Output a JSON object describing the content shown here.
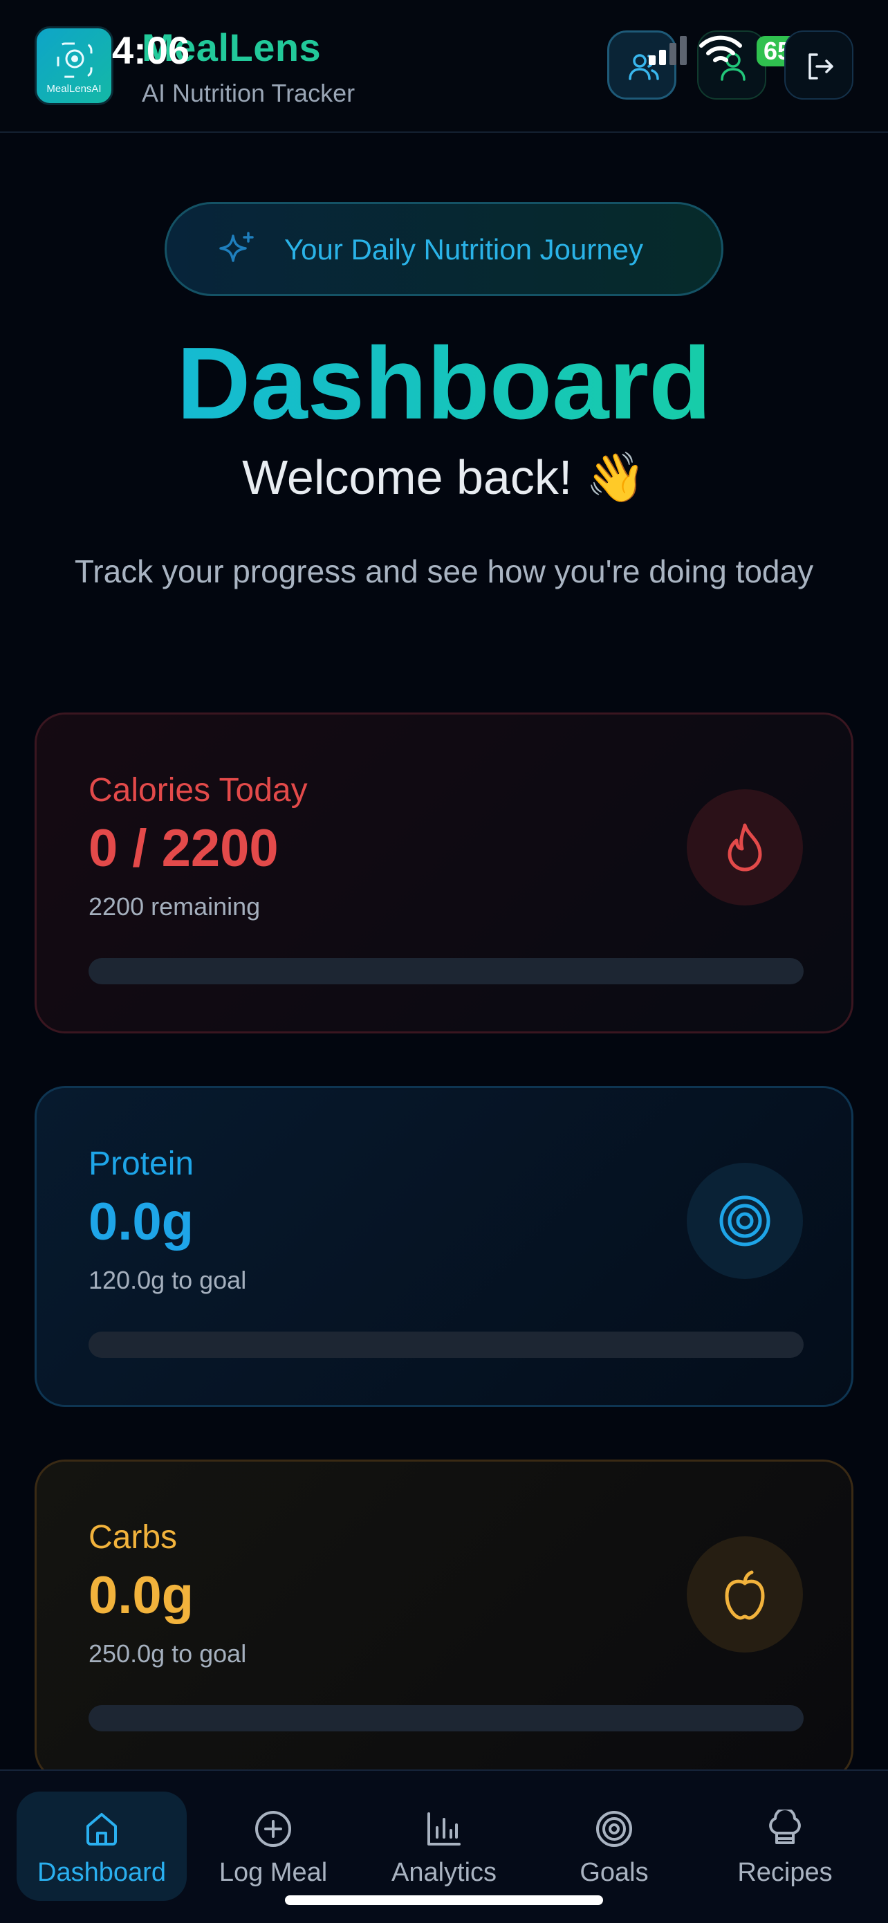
{
  "header": {
    "app_title": "MealLens",
    "app_subtitle": "AI Nutrition Tracker",
    "logo_text": "MealLensAI",
    "status_time": "4:06",
    "battery": "65"
  },
  "hero": {
    "pill_text": "Your Daily Nutrition Journey",
    "title": "Dashboard",
    "welcome": "Welcome back! 👋",
    "tagline": "Track your progress and see how you're doing today"
  },
  "cards": {
    "calories": {
      "label": "Calories Today",
      "value": "0 / 2200",
      "sub": "2200 remaining",
      "progress": 0,
      "color": "#e34a4a",
      "icon": "flame-icon"
    },
    "protein": {
      "label": "Protein",
      "value": "0.0g",
      "sub": "120.0g to goal",
      "progress": 0,
      "color": "#1ea5e8",
      "icon": "target-icon"
    },
    "carbs": {
      "label": "Carbs",
      "value": "0.0g",
      "sub": "250.0g to goal",
      "progress": 0,
      "color": "#f2b33c",
      "icon": "apple-icon"
    }
  },
  "nav": {
    "items": [
      {
        "label": "Dashboard",
        "icon": "home-icon",
        "active": true
      },
      {
        "label": "Log Meal",
        "icon": "plus-circle-icon",
        "active": false
      },
      {
        "label": "Analytics",
        "icon": "bar-chart-icon",
        "active": false
      },
      {
        "label": "Goals",
        "icon": "target-icon",
        "active": false
      },
      {
        "label": "Recipes",
        "icon": "chef-hat-icon",
        "active": false
      }
    ]
  },
  "colors": {
    "accent": "#2ab0f0",
    "brand": "#22c99a",
    "background": "#02060f"
  }
}
